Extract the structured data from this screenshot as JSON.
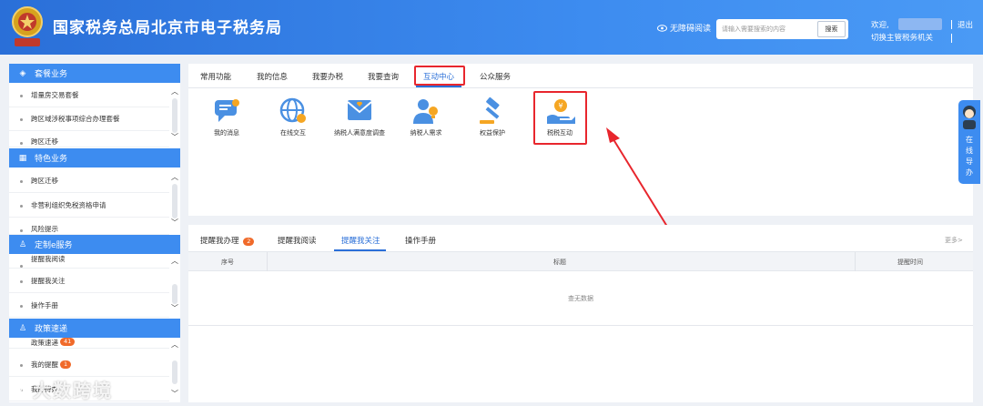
{
  "header": {
    "title": "国家税务总局北京市电子税务局",
    "emblem_text": "税务总局",
    "accessibility_label": "无障碍阅读",
    "search": {
      "placeholder": "请输入需要搜索的内容",
      "button_label": "搜索"
    },
    "welcome": "欢迎,",
    "switch_org": "切换主管税务机关",
    "logout": "退出"
  },
  "sidebar": {
    "sections": [
      {
        "title": "套餐业务",
        "items": [
          "增量房交易套餐",
          "跨区域涉税事项综合办理套餐",
          "跨区迁移"
        ]
      },
      {
        "title": "特色业务",
        "items": [
          "跨区迁移",
          "非营利组织免税资格申请",
          "风险提示"
        ]
      },
      {
        "title": "定制e服务",
        "items": [
          "提醒我阅读",
          "提醒我关注",
          "操作手册"
        ]
      },
      {
        "title": "政策速递",
        "items": [
          "政策速递",
          "我的提醒",
          "我的待办"
        ],
        "badges": [
          "41",
          "1",
          ""
        ]
      }
    ]
  },
  "top_tabs": [
    "常用功能",
    "我的信息",
    "我要办税",
    "我要查询",
    "互动中心",
    "公众服务"
  ],
  "active_top_tab": "互动中心",
  "functions": [
    {
      "label": "我的消息",
      "icon": "message-icon"
    },
    {
      "label": "在线交互",
      "icon": "globe-icon"
    },
    {
      "label": "纳税人满意度调查",
      "icon": "survey-envelope-icon"
    },
    {
      "label": "纳税人需求",
      "icon": "person-lightbulb-icon"
    },
    {
      "label": "权益保护",
      "icon": "gavel-icon"
    },
    {
      "label": "税税互动",
      "icon": "hand-coin-icon"
    }
  ],
  "bottom_tabs": [
    "提醒我办理",
    "提醒我阅读",
    "提醒我关注",
    "操作手册"
  ],
  "bottom_tab_badge": "2",
  "active_bottom_tab": "提醒我关注",
  "more_label": "更多>",
  "table": {
    "headers": [
      "序号",
      "标题",
      "提醒时间"
    ],
    "empty_text": "查无数据"
  },
  "guide": {
    "text": "在线导办",
    "chars": [
      "在",
      "线",
      "导",
      "办"
    ]
  },
  "watermark": "大数跨境",
  "colors": {
    "primary": "#2a6fd8",
    "highlight": "#e8262d",
    "badge": "#f06a2a"
  }
}
